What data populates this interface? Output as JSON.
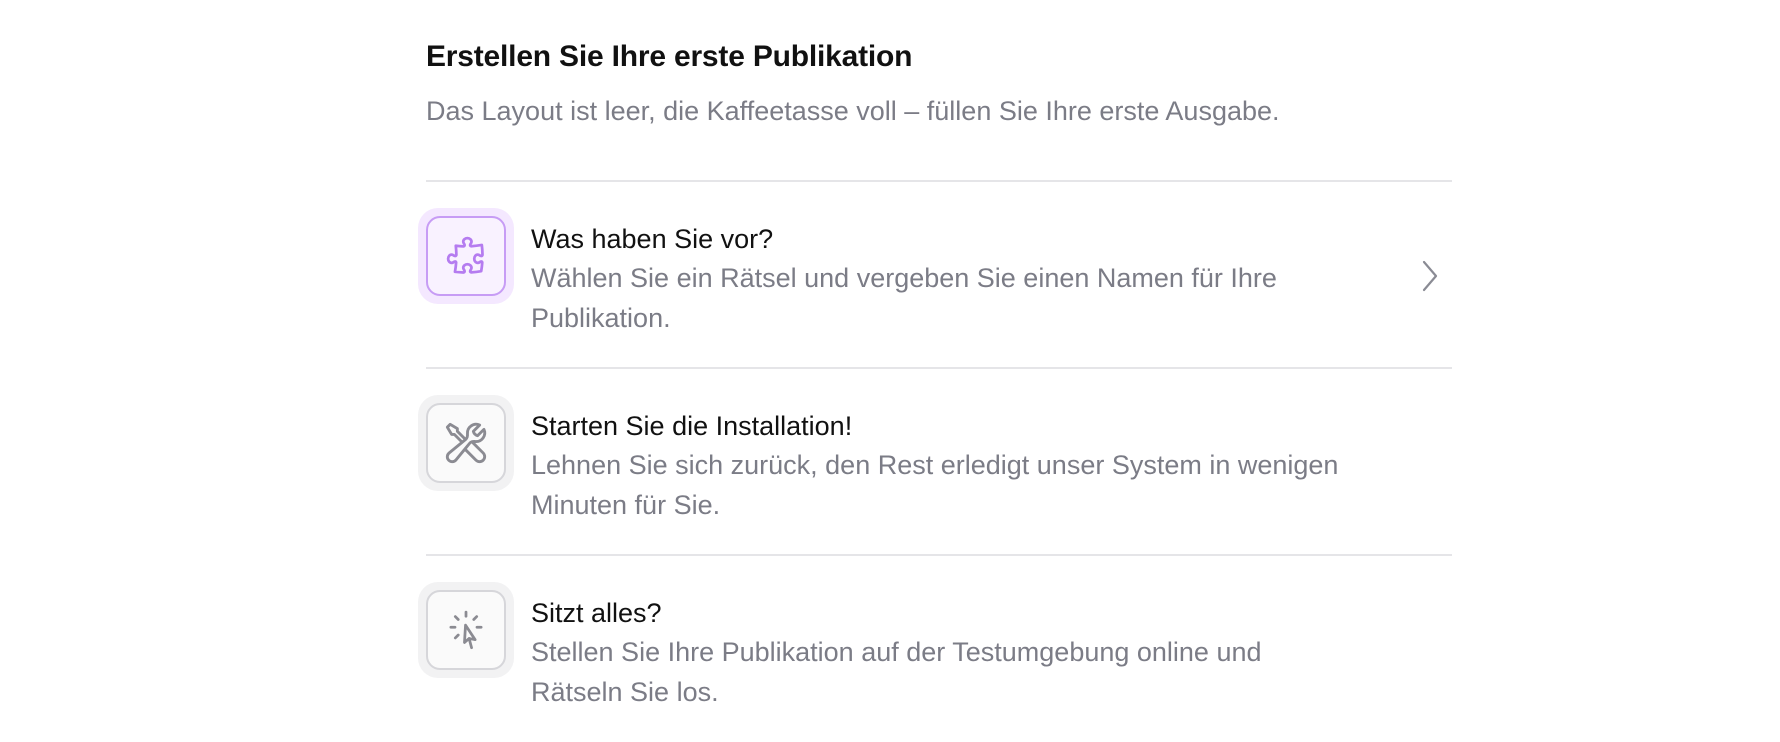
{
  "header": {
    "title": "Erstellen Sie Ihre erste Publikation",
    "subtitle": "Das Layout ist leer, die Kaffeetasse voll – füllen Sie Ihre erste Ausgabe."
  },
  "steps": [
    {
      "title": "Was haben Sie vor?",
      "description": "Wählen Sie ein Rätsel und vergeben Sie einen Namen für Ihre Publikation.",
      "icon": "puzzle-icon",
      "active": true
    },
    {
      "title": "Starten Sie die Installation!",
      "description": "Lehnen Sie sich zurück, den Rest erledigt unser System in wenigen Minuten für Sie.",
      "icon": "tools-icon",
      "active": false
    },
    {
      "title": "Sitzt alles?",
      "description": "Stellen Sie Ihre Publikation auf der Testumgebung online und Rätseln Sie los.",
      "icon": "cursor-click-icon",
      "active": false
    }
  ],
  "colors": {
    "accent": "#a855f7",
    "accent_bg": "#f4e8ff",
    "muted_text": "#7b7c86",
    "divider": "#e5e5e8"
  }
}
